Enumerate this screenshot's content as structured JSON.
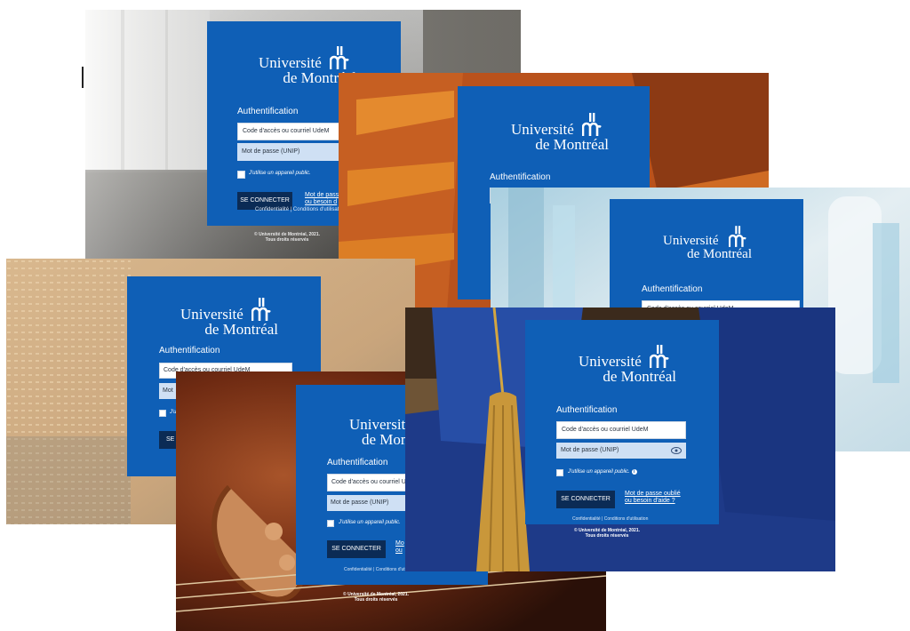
{
  "login": {
    "brand_line1": "Université",
    "brand_line2": "de Montréal",
    "heading": "Authentification",
    "username_placeholder": "Code d'accès ou courriel UdeM",
    "password_placeholder": "Mot de passe (UNIP)",
    "public_device": "J'utilise un appareil public.",
    "connect_button": "SE CONNECTER",
    "help_link_line1": "Mot de passe oublié",
    "help_link_line2": "ou besoin d'aide ?",
    "footer_links": "Confidentialité | Conditions d'utilisation",
    "copyright_line1": "© Université de Montréal, 2021.",
    "copyright_line2": "Tous droits réservés"
  },
  "partial_labels": {
    "help_link_line1_a": "Mot de pass",
    "help_link_line2_a": "ou besoin d",
    "footer_a": "Confidentialité | Conditions d'utilisat",
    "username_c": "Code d'accès ou courriel UdeM",
    "username_d": "Code d'accès ou courriel UdeM",
    "password_d": "Mot",
    "public_d": "J'uti",
    "button_d": "SE",
    "brand1_e": "Université",
    "brand2_e": "de Mon",
    "username_e": "Code d'accès ou courriel U",
    "public_e": "J'utilise un appareil public.",
    "help_link_line1_e": "Mo",
    "help_link_line2_e": "ou",
    "footer_e": "Confidentialité | Conditions d'utilisation",
    "copyright_line1_e": "© Université de Montréal, 2021.",
    "copyright_line2_e": "Tous droits réservés"
  },
  "theme": {
    "panel_blue": "#0f5fb6",
    "button_navy": "#0b2b55",
    "password_field": "#cfe0f4"
  }
}
